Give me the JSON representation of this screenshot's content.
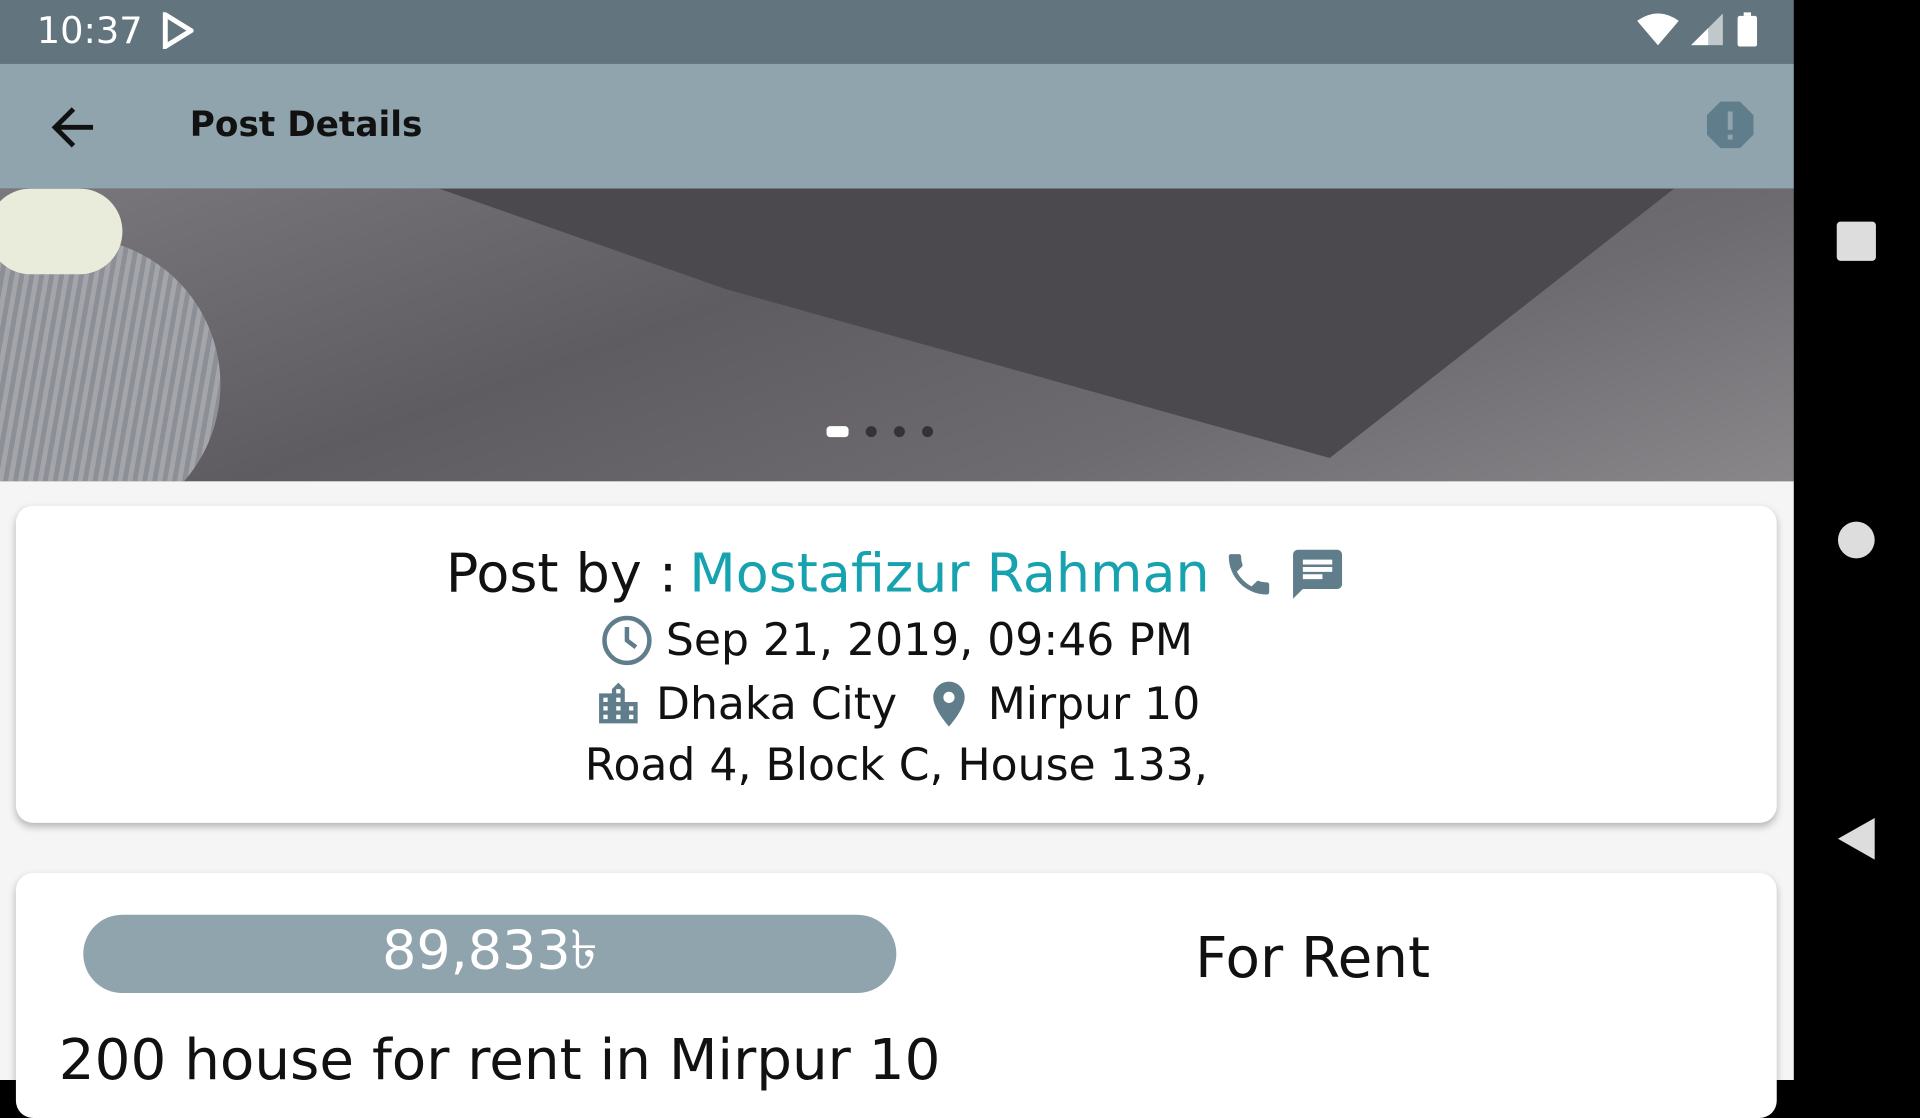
{
  "status_bar": {
    "time": "10:37"
  },
  "app_bar": {
    "title": "Post Details"
  },
  "carousel": {
    "count": 4,
    "active_index": 0
  },
  "post_info": {
    "post_by_label": "Post by :",
    "author": "Mostafizur Rahman",
    "date": "Sep 21, 2019, 09:46 PM",
    "city": "Dhaka City",
    "area": "Mirpur 10",
    "address": "Road 4, Block C, House 133,"
  },
  "listing": {
    "price": "89,833৳",
    "type": "For Rent",
    "title": "200 house for rent in Mirpur 10"
  },
  "colors": {
    "accent": "#17a2b0",
    "app_bar": "#90a4ae",
    "status_bar": "#62757f"
  }
}
